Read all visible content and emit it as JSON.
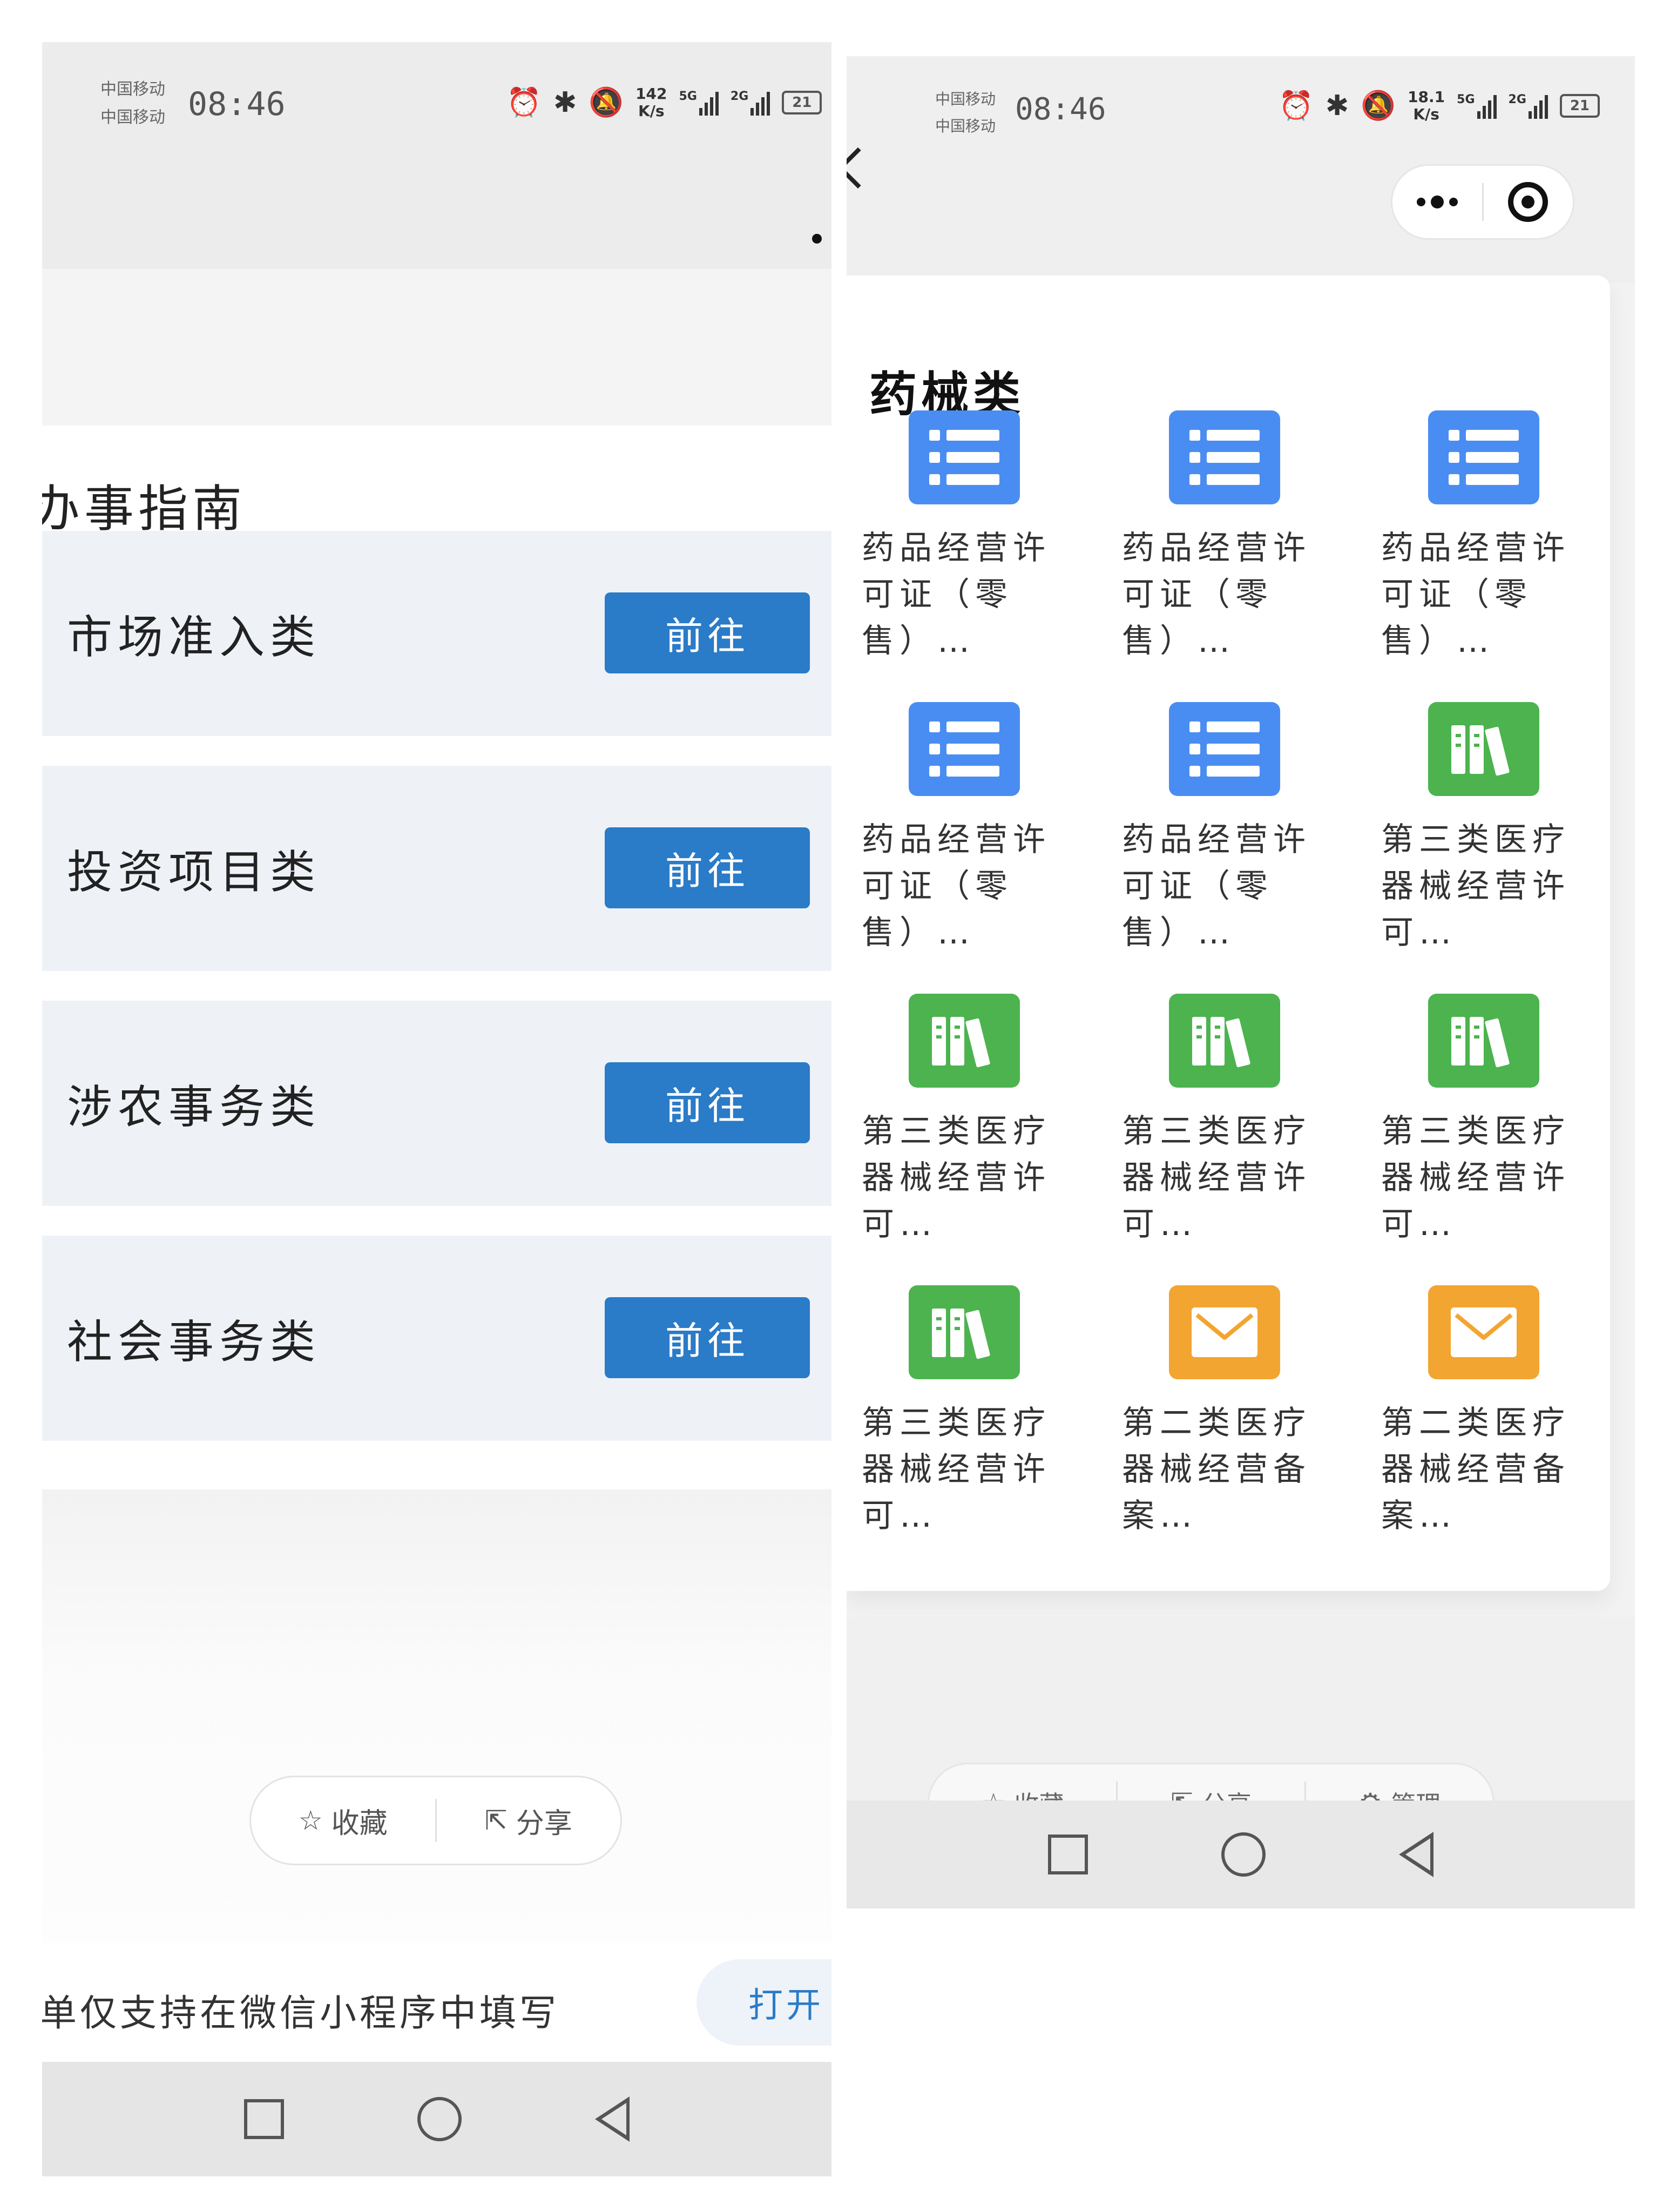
{
  "left": {
    "status": {
      "carrier1": "中国移动",
      "carrier2": "中国移动",
      "time": "08:46",
      "netspeed_value": "142",
      "netspeed_unit": "K/s",
      "sig1_label": "5G",
      "sig2_label": "2G",
      "battery": "21"
    },
    "guide_title": "办事指南",
    "categories": [
      {
        "label": "市场准入类",
        "button": "前往"
      },
      {
        "label": "投资项目类",
        "button": "前往"
      },
      {
        "label": "涉农事务类",
        "button": "前往"
      },
      {
        "label": "社会事务类",
        "button": "前往"
      }
    ],
    "actions": {
      "favorite_label": "收藏",
      "share_label": "分享"
    },
    "notice_text": "单仅支持在微信小程序中填写",
    "open_button": "打开"
  },
  "right": {
    "status": {
      "carrier1": "中国移动",
      "carrier2": "中国移动",
      "time": "08:46",
      "netspeed_value": "18.1",
      "netspeed_unit": "K/s",
      "sig1_label": "5G",
      "sig2_label": "2G",
      "battery": "21"
    },
    "section_title": "药械类",
    "items": [
      {
        "label": "药品经营许可证（零售）…",
        "icon": "list-icon",
        "color": "#4a8df2"
      },
      {
        "label": "药品经营许可证（零售）…",
        "icon": "list-icon",
        "color": "#4a8df2"
      },
      {
        "label": "药品经营许可证（零售）…",
        "icon": "list-icon",
        "color": "#4a8df2"
      },
      {
        "label": "药品经营许可证（零售）…",
        "icon": "list-icon",
        "color": "#4a8df2"
      },
      {
        "label": "药品经营许可证（零售）…",
        "icon": "list-icon",
        "color": "#4a8df2"
      },
      {
        "label": "第三类医疗器械经营许可…",
        "icon": "books-icon",
        "color": "#4cb34f"
      },
      {
        "label": "第三类医疗器械经营许可…",
        "icon": "books-icon",
        "color": "#4cb34f"
      },
      {
        "label": "第三类医疗器械经营许可…",
        "icon": "books-icon",
        "color": "#4cb34f"
      },
      {
        "label": "第三类医疗器械经营许可…",
        "icon": "books-icon",
        "color": "#4cb34f"
      },
      {
        "label": "第三类医疗器械经营许可…",
        "icon": "books-icon",
        "color": "#4cb34f"
      },
      {
        "label": "第二类医疗器械经营备案…",
        "icon": "envelope-icon",
        "color": "#f2a531"
      },
      {
        "label": "第二类医疗器械经营备案…",
        "icon": "envelope-icon",
        "color": "#f2a531"
      }
    ],
    "actions": {
      "favorite_label": "收藏",
      "share_label": "分享",
      "manage_label": "管理"
    }
  }
}
